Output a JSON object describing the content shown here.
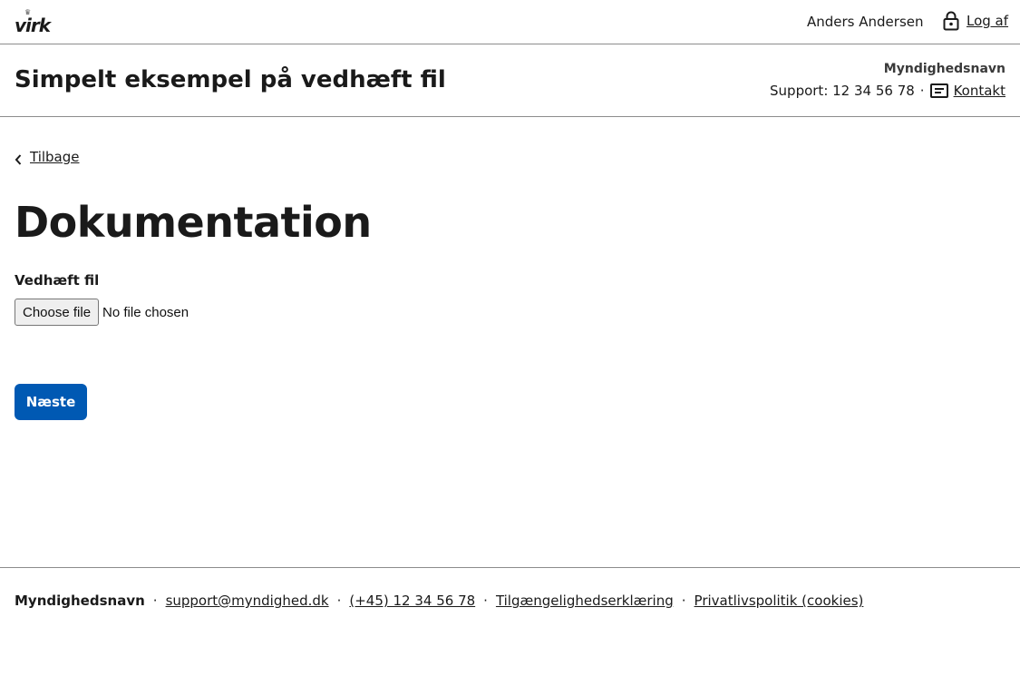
{
  "topbar": {
    "logo_text": "virk",
    "user_name": "Anders Andersen",
    "logout_label": "Log af",
    "logout_icon": "lock-icon"
  },
  "header": {
    "title": "Simpelt eksempel på vedhæft fil",
    "authority": "Myndighedsnavn",
    "support_text": "Support: 12 34 56 78",
    "separator": "·",
    "contact_icon": "contact-card-icon",
    "contact_label": "Kontakt"
  },
  "main": {
    "back_label": "Tilbage",
    "back_icon": "chevron-left-icon",
    "page_title": "Dokumentation",
    "field_label": "Vedhæft fil",
    "file_button_label": "Choose file",
    "file_status": "No file chosen",
    "next_label": "Næste"
  },
  "footer": {
    "authority": "Myndighedsnavn",
    "separator": "·",
    "links": [
      "support@myndighed.dk",
      "(+45) 12 34 56 78",
      "Tilgængelighedserklæring",
      "Privatlivspolitik (cookies)"
    ]
  },
  "colors": {
    "primary_button": "#0059b3",
    "divider": "#8c8c8c",
    "text": "#1a1a1a"
  }
}
